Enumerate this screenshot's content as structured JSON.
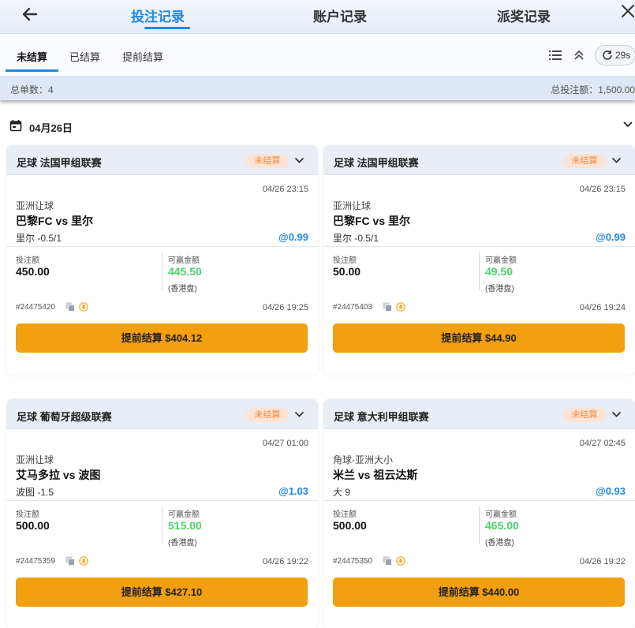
{
  "header": {
    "tabs": [
      "投注记录",
      "账户记录",
      "派奖记录"
    ]
  },
  "subtabs": [
    "未结算",
    "已结算",
    "提前结算"
  ],
  "refresh": {
    "label": "29s"
  },
  "summary": {
    "count": "总单数：4",
    "total": "总投注额：1,500.00"
  },
  "date_group": {
    "label": "04月26日"
  },
  "colors": {
    "accent": "#1e88e5",
    "win": "#4cd06a",
    "cashout_button": "#f29f10",
    "badge_text": "#f08a3e"
  },
  "bets": [
    {
      "league": "足球 法国甲组联赛",
      "status": "未结算",
      "match_time": "04/26 23:15",
      "bet_type": "亚洲让球",
      "match": "巴黎FC vs 里尔",
      "selection": "里尔 -0.5/1",
      "odds": "@0.99",
      "stake_label": "投注额",
      "stake": "450.00",
      "win_label": "可赢金额",
      "win": "445.50",
      "odds_type": "(香港盘)",
      "order_id": "#24475420",
      "bet_time": "04/26 19:25",
      "cashout": "提前结算 $404.12"
    },
    {
      "league": "足球 法国甲组联赛",
      "status": "未结算",
      "match_time": "04/26 23:15",
      "bet_type": "亚洲让球",
      "match": "巴黎FC vs 里尔",
      "selection": "里尔 -0.5/1",
      "odds": "@0.99",
      "stake_label": "投注额",
      "stake": "50.00",
      "win_label": "可赢金额",
      "win": "49.50",
      "odds_type": "(香港盘)",
      "order_id": "#24475403",
      "bet_time": "04/26 19:24",
      "cashout": "提前结算 $44.90"
    },
    {
      "league": "足球 葡萄牙超级联赛",
      "status": "未结算",
      "match_time": "04/27 01:00",
      "bet_type": "亚洲让球",
      "match": "艾马多拉 vs 波图",
      "selection": "波图 -1.5",
      "odds": "@1.03",
      "stake_label": "投注额",
      "stake": "500.00",
      "win_label": "可赢金额",
      "win": "515.00",
      "odds_type": "(香港盘)",
      "order_id": "#24475359",
      "bet_time": "04/26 19:22",
      "cashout": "提前结算 $427.10"
    },
    {
      "league": "足球 意大利甲组联赛",
      "status": "未结算",
      "match_time": "04/27 02:45",
      "bet_type": "角球-亚洲大小",
      "match": "米兰 vs 祖云达斯",
      "selection": "大 9",
      "odds": "@0.93",
      "stake_label": "投注额",
      "stake": "500.00",
      "win_label": "可赢金额",
      "win": "465.00",
      "odds_type": "(香港盘)",
      "order_id": "#24475350",
      "bet_time": "04/26 19:22",
      "cashout": "提前结算 $440.00"
    }
  ]
}
